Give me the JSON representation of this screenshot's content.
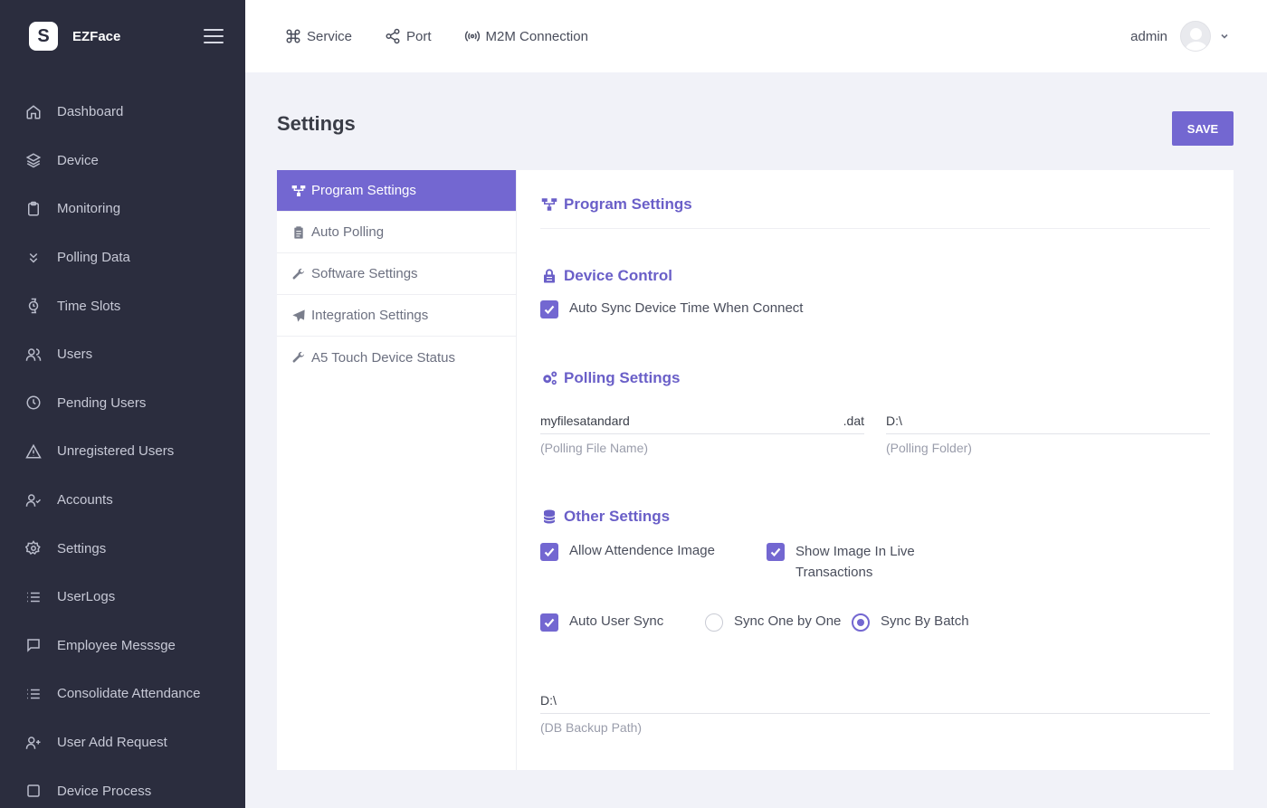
{
  "brand": {
    "name": "EZFace",
    "logo_letter": "S"
  },
  "sidebar": {
    "items": [
      {
        "label": "Dashboard",
        "icon": "home-icon"
      },
      {
        "label": "Device",
        "icon": "layers-icon"
      },
      {
        "label": "Monitoring",
        "icon": "clipboard-icon"
      },
      {
        "label": "Polling Data",
        "icon": "chevrons-down-icon"
      },
      {
        "label": "Time Slots",
        "icon": "watch-icon"
      },
      {
        "label": "Users",
        "icon": "users-icon"
      },
      {
        "label": "Pending Users",
        "icon": "clock-icon"
      },
      {
        "label": "Unregistered Users",
        "icon": "alert-triangle-icon"
      },
      {
        "label": "Accounts",
        "icon": "user-check-icon"
      },
      {
        "label": "Settings",
        "icon": "gear-icon"
      },
      {
        "label": "UserLogs",
        "icon": "list-icon"
      },
      {
        "label": "Employee Messsge",
        "icon": "message-square-icon"
      },
      {
        "label": "Consolidate Attendance",
        "icon": "list-icon"
      },
      {
        "label": "User Add Request",
        "icon": "user-plus-icon"
      },
      {
        "label": "Device Process",
        "icon": "square-icon"
      }
    ]
  },
  "topbar": {
    "links": [
      {
        "label": "Service",
        "icon": "command-icon"
      },
      {
        "label": "Port",
        "icon": "share-icon"
      },
      {
        "label": "M2M Connection",
        "icon": "broadcast-icon"
      }
    ],
    "user_name": "admin"
  },
  "page": {
    "title": "Settings",
    "save_label": "SAVE"
  },
  "tabs": [
    {
      "label": "Program Settings",
      "icon": "sitemap-icon",
      "active": true
    },
    {
      "label": "Auto Polling",
      "icon": "clipboard-icon",
      "active": false
    },
    {
      "label": "Software Settings",
      "icon": "wrench-icon",
      "active": false
    },
    {
      "label": "Integration Settings",
      "icon": "paper-plane-icon",
      "active": false
    },
    {
      "label": "A5 Touch Device Status",
      "icon": "wrench-icon",
      "active": false
    }
  ],
  "pane": {
    "title": "Program Settings",
    "device_control": {
      "title": "Device Control",
      "auto_sync_label": "Auto Sync Device Time When Connect",
      "auto_sync_checked": true
    },
    "polling": {
      "title": "Polling Settings",
      "file_name_value": "myfilesatandard",
      "file_ext": ".dat",
      "file_name_hint": "(Polling File Name)",
      "folder_value": "D:\\",
      "folder_hint": "(Polling Folder)"
    },
    "other": {
      "title": "Other Settings",
      "allow_image_label": "Allow Attendence Image",
      "allow_image_checked": true,
      "show_image_label_line1": "Show Image In Live",
      "show_image_label_line2": "Transactions",
      "show_image_checked": true,
      "auto_user_sync_label": "Auto User Sync",
      "auto_user_sync_checked": true,
      "sync_one_label": "Sync One by One",
      "sync_batch_label": "Sync By Batch",
      "sync_mode": "Sync By Batch",
      "db_backup_value": "D:\\",
      "db_backup_hint": "(DB Backup Path)"
    }
  },
  "colors": {
    "sidebar_bg": "#2b2d3e",
    "accent": "#7367d1",
    "page_bg": "#f1f2f8"
  }
}
